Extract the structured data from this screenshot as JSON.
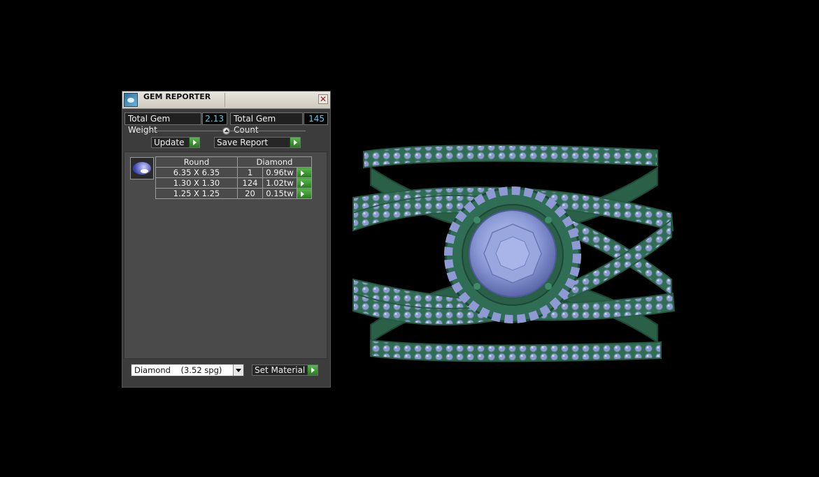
{
  "panel": {
    "title": "GEM REPORTER",
    "total_weight_label": "Total Gem Weight",
    "total_weight_value": "2.13",
    "total_count_label": "Total Gem Count",
    "total_count_value": "145",
    "update_label": "Update",
    "save_report_label": "Save Report",
    "gem_table": {
      "header": [
        "Round",
        "Diamond"
      ],
      "rows": [
        {
          "size": "6.35 X 6.35",
          "count": "1",
          "weight": "0.96tw"
        },
        {
          "size": "1.30 X 1.30",
          "count": "124",
          "weight": "1.02tw"
        },
        {
          "size": "1.25 X 1.25",
          "count": "20",
          "weight": "0.15tw"
        }
      ]
    },
    "material_select": "Diamond    (3.52 spg)",
    "set_material_label": "Set Material"
  },
  "colors": {
    "background": "#000000",
    "panel": "#3c3c3c",
    "accent_green": "#3c9c32",
    "value_cyan": "#5ec8e8",
    "ring_metal": "#2f6e55",
    "gem_blue": "#8a98d6"
  },
  "icons": [
    "gem-reporter-app-icon",
    "close-icon",
    "play-arrow-icon",
    "dropdown-arrow-icon",
    "round-gem-icon"
  ]
}
